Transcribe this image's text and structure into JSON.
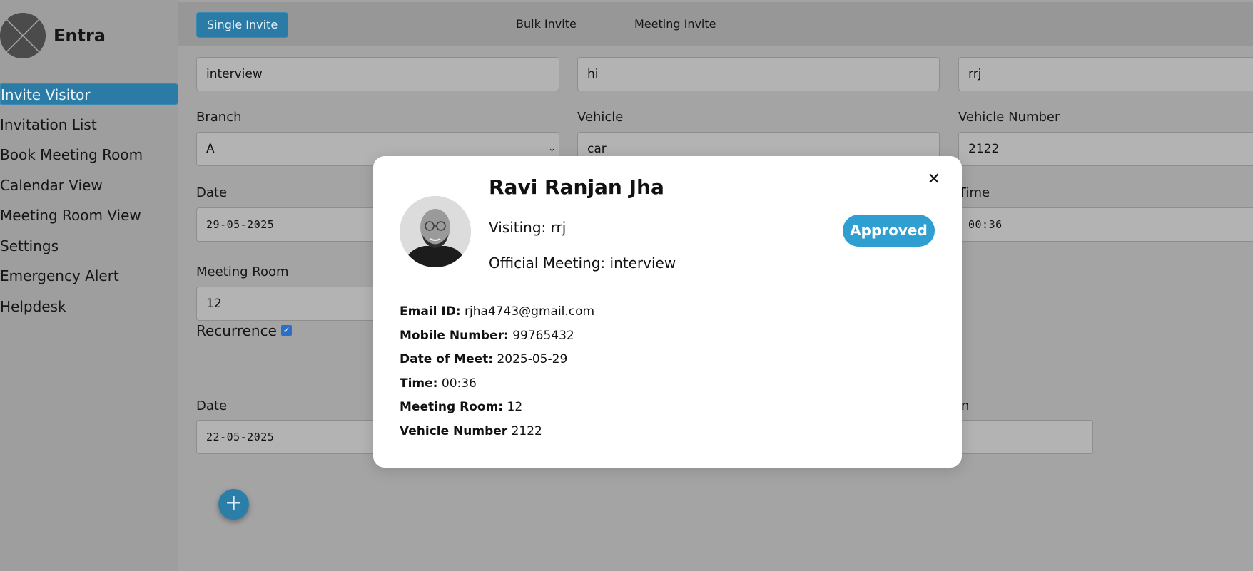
{
  "app": {
    "name": "Entra"
  },
  "sidebar": {
    "items": [
      {
        "label": "Invite Visitor",
        "active": true
      },
      {
        "label": "Invitation List"
      },
      {
        "label": "Book Meeting Room"
      },
      {
        "label": "Calendar View"
      },
      {
        "label": "Meeting Room View"
      },
      {
        "label": "Settings"
      },
      {
        "label": "Emergency Alert"
      },
      {
        "label": "Helpdesk"
      }
    ]
  },
  "tabs": [
    {
      "label": "Single Invite",
      "active": true
    },
    {
      "label": "Bulk Invite"
    },
    {
      "label": "Meeting Invite"
    }
  ],
  "form": {
    "purpose_value": "interview",
    "entry_point_value": "hi",
    "host_value": "rrj",
    "branch_label": "Branch",
    "branch_value": "A",
    "vehicle_label": "Vehicle",
    "vehicle_value": "car",
    "vehicle_number_label": "Vehicle Number",
    "vehicle_number_value": "2122",
    "date_label": "Date",
    "date_value": "29-05-2025",
    "time_label": "Time",
    "time_value": "00:36",
    "meeting_room_label": "Meeting Room",
    "meeting_room_value": "12",
    "recurrence_label": "Recurrence",
    "recurrence_checked": true,
    "recurrence_date_label": "Date",
    "recurrence_date_value": "22-05-2025",
    "recurrence_right_label_partial": "n"
  },
  "modal": {
    "name": "Ravi Ranjan Jha",
    "visiting_prefix": "Visiting:",
    "visiting_value": "rrj",
    "official_prefix": "Official Meeting:",
    "official_value": "interview",
    "status": "Approved",
    "status_color": "#2f9ed1",
    "details": [
      {
        "label": "Email ID:",
        "value": "rjha4743@gmail.com"
      },
      {
        "label": "Mobile Number:",
        "value": "99765432"
      },
      {
        "label": "Date of Meet:",
        "value": "2025-05-29"
      },
      {
        "label": "Time:",
        "value": "00:36"
      },
      {
        "label": "Meeting Room:",
        "value": "12"
      },
      {
        "label": "Vehicle Number",
        "value": "2122"
      }
    ],
    "close_icon": "close-icon"
  },
  "colors": {
    "accent": "#2a7ca6",
    "overlay_bg": "#a3a3a3"
  }
}
